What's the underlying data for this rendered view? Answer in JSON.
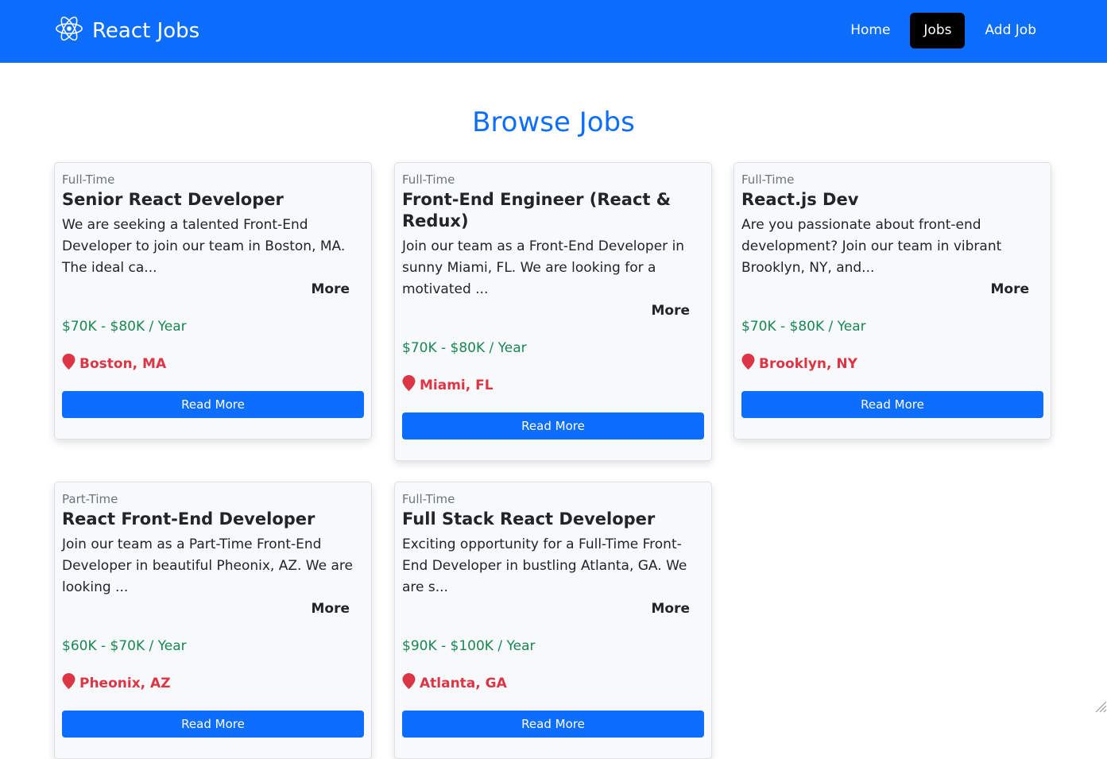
{
  "nav": {
    "brand": "React Jobs",
    "links": [
      "Home",
      "Jobs",
      "Add Job"
    ]
  },
  "page_title": "Browse Jobs",
  "jobs": [
    {
      "type": "Full-Time",
      "title": "Senior React Developer",
      "description": "We are seeking a talented Front-End Developer to join our team in Boston, MA. The ideal ca...",
      "more": "More",
      "salary": "$70K - $80K / Year",
      "location": "Boston, MA",
      "button": "Read More"
    },
    {
      "type": "Full-Time",
      "title": "Front-End Engineer (React & Redux)",
      "description": "Join our team as a Front-End Developer in sunny Miami, FL. We are looking for a motivated ...",
      "more": "More",
      "salary": "$70K - $80K / Year",
      "location": "Miami, FL",
      "button": "Read More"
    },
    {
      "type": "Full-Time",
      "title": "React.js Dev",
      "description": "Are you passionate about front-end development? Join our team in vibrant Brooklyn, NY, and...",
      "more": "More",
      "salary": "$70K - $80K / Year",
      "location": "Brooklyn, NY",
      "button": "Read More"
    },
    {
      "type": "Part-Time",
      "title": "React Front-End Developer",
      "description": "Join our team as a Part-Time Front-End Developer in beautiful Pheonix, AZ. We are looking ...",
      "more": "More",
      "salary": "$60K - $70K / Year",
      "location": "Pheonix, AZ",
      "button": "Read More"
    },
    {
      "type": "Full-Time",
      "title": "Full Stack React Developer",
      "description": "Exciting opportunity for a Full-Time Front-End Developer in bustling Atlanta, GA. We are s...",
      "more": "More",
      "salary": "$90K - $100K / Year",
      "location": "Atlanta, GA",
      "button": "Read More"
    }
  ],
  "colors": {
    "primary": "#0d6efd",
    "salary": "#198754",
    "location": "#dc3545",
    "active_nav": "#000000"
  }
}
